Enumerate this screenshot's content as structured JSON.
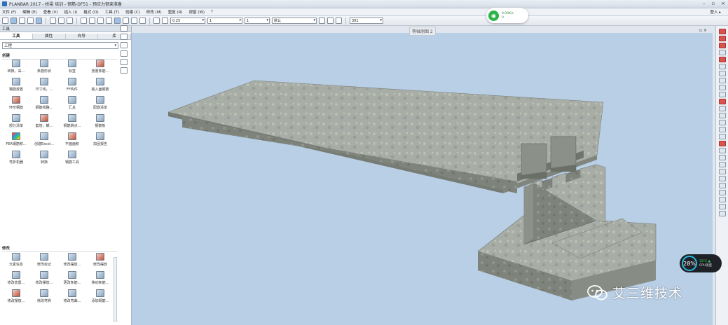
{
  "window": {
    "title": "PLANBAR 2017 - 桥梁 培训 - 钢筋-DF51 - 预应力钢束准备",
    "controls": [
      "–",
      "▫",
      "×"
    ]
  },
  "menu": {
    "items": [
      "文件 (F)",
      "编辑 (E)",
      "查看 (V)",
      "插入 (I)",
      "格式 (O)",
      "工具 (T)",
      "创建 (C)",
      "修改 (M)",
      "重复 (R)",
      "视窗 (W)",
      "?"
    ],
    "login": "登入 ▸"
  },
  "toolbar": {
    "pen_value": "0.25",
    "line_value": "1",
    "color_value": "1",
    "layer_value": "默认",
    "hatch_value": "301"
  },
  "network_widget": {
    "upload": "0.00K/s",
    "download": "0"
  },
  "viewport": {
    "label": "等轴测图 2",
    "controls": "▫ ×"
  },
  "left_panel": {
    "title": "工具",
    "close": "ᵩ ×",
    "tabs": [
      "工具",
      "属性",
      "向导",
      "库"
    ],
    "palette": "工程",
    "create_section": "创建",
    "create_tools": [
      {
        "label": "转换，采...",
        "icon": "convert-icon"
      },
      {
        "label": "条筋形状",
        "icon": "bar-shape-icon"
      },
      {
        "label": "标签",
        "icon": "label-icon"
      },
      {
        "label": "放置条筋...",
        "icon": "place-bars-icon"
      },
      {
        "label": "钢筋放置",
        "icon": "rebar-place-icon"
      },
      {
        "label": "尺寸线，...",
        "icon": "dimension-icon"
      },
      {
        "label": "FF构件",
        "icon": "ff-component-icon"
      },
      {
        "label": "输入面钢筋",
        "icon": "mesh-input-icon"
      },
      {
        "label": "环形钢筋",
        "icon": "ring-rebar-icon"
      },
      {
        "label": "钢筋线路...",
        "icon": "rebar-line-icon"
      },
      {
        "label": "汇总",
        "icon": "summary-icon"
      },
      {
        "label": "配筋清单",
        "icon": "schedule-icon"
      },
      {
        "label": "部分清单",
        "icon": "partial-list-icon"
      },
      {
        "label": "套管，螺...",
        "icon": "coupler-icon"
      },
      {
        "label": "钢筋跳点...",
        "icon": "rebar-jump-icon"
      },
      {
        "label": "钢筋板",
        "icon": "rebar-slab-icon"
      },
      {
        "label": "FEA钢筋积...",
        "icon": "fea-icon"
      },
      {
        "label": "创建Excel...",
        "icon": "excel-icon"
      },
      {
        "label": "平面面积",
        "icon": "plane-area-icon"
      },
      {
        "label": "加固报告",
        "icon": "report-icon"
      },
      {
        "label": "弯折机器",
        "icon": "bending-machine-icon"
      },
      {
        "label": "转换",
        "icon": "transform-icon"
      },
      {
        "label": "钢筋工具",
        "icon": "rebar-tools-icon"
      }
    ],
    "modify_section": "修改",
    "modify_tools": [
      {
        "label": "元素信息",
        "icon": "element-info-icon"
      },
      {
        "label": "修改标记",
        "icon": "modify-mark-icon"
      },
      {
        "label": "修改摆放...",
        "icon": "modify-place-icon"
      },
      {
        "label": "修改摆放",
        "icon": "modify-placement-icon"
      },
      {
        "label": "修改放置...",
        "icon": "modify-position-icon"
      },
      {
        "label": "修改摆放...",
        "icon": "modify-arrange-icon"
      },
      {
        "label": "更改条筋...",
        "icon": "change-bars-icon"
      },
      {
        "label": "移动条筋...",
        "icon": "move-bars-icon"
      },
      {
        "label": "修改摆放...",
        "icon": "modify-layout-icon"
      },
      {
        "label": "修改弯钩",
        "icon": "modify-hook-icon"
      },
      {
        "label": "修改弯曲...",
        "icon": "modify-bend-icon"
      },
      {
        "label": "添加钢筋...",
        "icon": "add-rebar-icon"
      }
    ]
  },
  "cpu_widget": {
    "percent": "28%",
    "temp": "33°C ▲",
    "label": "CPU温度"
  },
  "watermark": {
    "text": "艾三维技术"
  }
}
